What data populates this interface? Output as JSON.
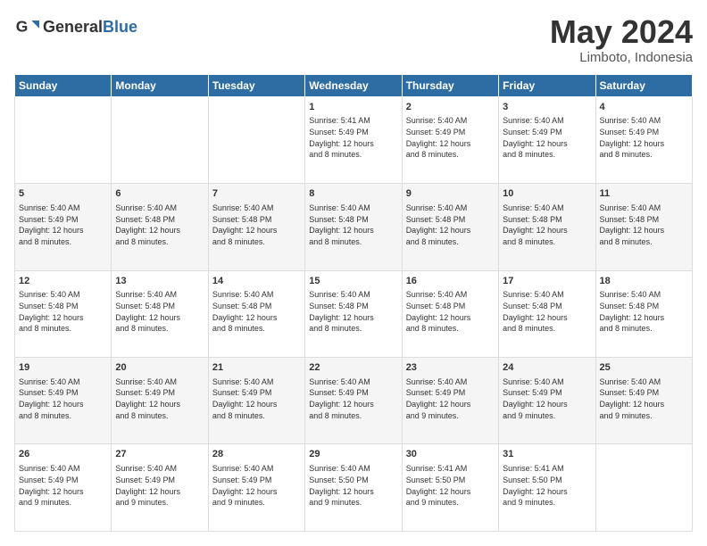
{
  "header": {
    "logo_general": "General",
    "logo_blue": "Blue",
    "month_year": "May 2024",
    "location": "Limboto, Indonesia"
  },
  "weekdays": [
    "Sunday",
    "Monday",
    "Tuesday",
    "Wednesday",
    "Thursday",
    "Friday",
    "Saturday"
  ],
  "weeks": [
    [
      {
        "day": "",
        "info": ""
      },
      {
        "day": "",
        "info": ""
      },
      {
        "day": "",
        "info": ""
      },
      {
        "day": "1",
        "info": "Sunrise: 5:41 AM\nSunset: 5:49 PM\nDaylight: 12 hours\nand 8 minutes."
      },
      {
        "day": "2",
        "info": "Sunrise: 5:40 AM\nSunset: 5:49 PM\nDaylight: 12 hours\nand 8 minutes."
      },
      {
        "day": "3",
        "info": "Sunrise: 5:40 AM\nSunset: 5:49 PM\nDaylight: 12 hours\nand 8 minutes."
      },
      {
        "day": "4",
        "info": "Sunrise: 5:40 AM\nSunset: 5:49 PM\nDaylight: 12 hours\nand 8 minutes."
      }
    ],
    [
      {
        "day": "5",
        "info": "Sunrise: 5:40 AM\nSunset: 5:49 PM\nDaylight: 12 hours\nand 8 minutes."
      },
      {
        "day": "6",
        "info": "Sunrise: 5:40 AM\nSunset: 5:48 PM\nDaylight: 12 hours\nand 8 minutes."
      },
      {
        "day": "7",
        "info": "Sunrise: 5:40 AM\nSunset: 5:48 PM\nDaylight: 12 hours\nand 8 minutes."
      },
      {
        "day": "8",
        "info": "Sunrise: 5:40 AM\nSunset: 5:48 PM\nDaylight: 12 hours\nand 8 minutes."
      },
      {
        "day": "9",
        "info": "Sunrise: 5:40 AM\nSunset: 5:48 PM\nDaylight: 12 hours\nand 8 minutes."
      },
      {
        "day": "10",
        "info": "Sunrise: 5:40 AM\nSunset: 5:48 PM\nDaylight: 12 hours\nand 8 minutes."
      },
      {
        "day": "11",
        "info": "Sunrise: 5:40 AM\nSunset: 5:48 PM\nDaylight: 12 hours\nand 8 minutes."
      }
    ],
    [
      {
        "day": "12",
        "info": "Sunrise: 5:40 AM\nSunset: 5:48 PM\nDaylight: 12 hours\nand 8 minutes."
      },
      {
        "day": "13",
        "info": "Sunrise: 5:40 AM\nSunset: 5:48 PM\nDaylight: 12 hours\nand 8 minutes."
      },
      {
        "day": "14",
        "info": "Sunrise: 5:40 AM\nSunset: 5:48 PM\nDaylight: 12 hours\nand 8 minutes."
      },
      {
        "day": "15",
        "info": "Sunrise: 5:40 AM\nSunset: 5:48 PM\nDaylight: 12 hours\nand 8 minutes."
      },
      {
        "day": "16",
        "info": "Sunrise: 5:40 AM\nSunset: 5:48 PM\nDaylight: 12 hours\nand 8 minutes."
      },
      {
        "day": "17",
        "info": "Sunrise: 5:40 AM\nSunset: 5:48 PM\nDaylight: 12 hours\nand 8 minutes."
      },
      {
        "day": "18",
        "info": "Sunrise: 5:40 AM\nSunset: 5:48 PM\nDaylight: 12 hours\nand 8 minutes."
      }
    ],
    [
      {
        "day": "19",
        "info": "Sunrise: 5:40 AM\nSunset: 5:49 PM\nDaylight: 12 hours\nand 8 minutes."
      },
      {
        "day": "20",
        "info": "Sunrise: 5:40 AM\nSunset: 5:49 PM\nDaylight: 12 hours\nand 8 minutes."
      },
      {
        "day": "21",
        "info": "Sunrise: 5:40 AM\nSunset: 5:49 PM\nDaylight: 12 hours\nand 8 minutes."
      },
      {
        "day": "22",
        "info": "Sunrise: 5:40 AM\nSunset: 5:49 PM\nDaylight: 12 hours\nand 8 minutes."
      },
      {
        "day": "23",
        "info": "Sunrise: 5:40 AM\nSunset: 5:49 PM\nDaylight: 12 hours\nand 9 minutes."
      },
      {
        "day": "24",
        "info": "Sunrise: 5:40 AM\nSunset: 5:49 PM\nDaylight: 12 hours\nand 9 minutes."
      },
      {
        "day": "25",
        "info": "Sunrise: 5:40 AM\nSunset: 5:49 PM\nDaylight: 12 hours\nand 9 minutes."
      }
    ],
    [
      {
        "day": "26",
        "info": "Sunrise: 5:40 AM\nSunset: 5:49 PM\nDaylight: 12 hours\nand 9 minutes."
      },
      {
        "day": "27",
        "info": "Sunrise: 5:40 AM\nSunset: 5:49 PM\nDaylight: 12 hours\nand 9 minutes."
      },
      {
        "day": "28",
        "info": "Sunrise: 5:40 AM\nSunset: 5:49 PM\nDaylight: 12 hours\nand 9 minutes."
      },
      {
        "day": "29",
        "info": "Sunrise: 5:40 AM\nSunset: 5:50 PM\nDaylight: 12 hours\nand 9 minutes."
      },
      {
        "day": "30",
        "info": "Sunrise: 5:41 AM\nSunset: 5:50 PM\nDaylight: 12 hours\nand 9 minutes."
      },
      {
        "day": "31",
        "info": "Sunrise: 5:41 AM\nSunset: 5:50 PM\nDaylight: 12 hours\nand 9 minutes."
      },
      {
        "day": "",
        "info": ""
      }
    ]
  ]
}
